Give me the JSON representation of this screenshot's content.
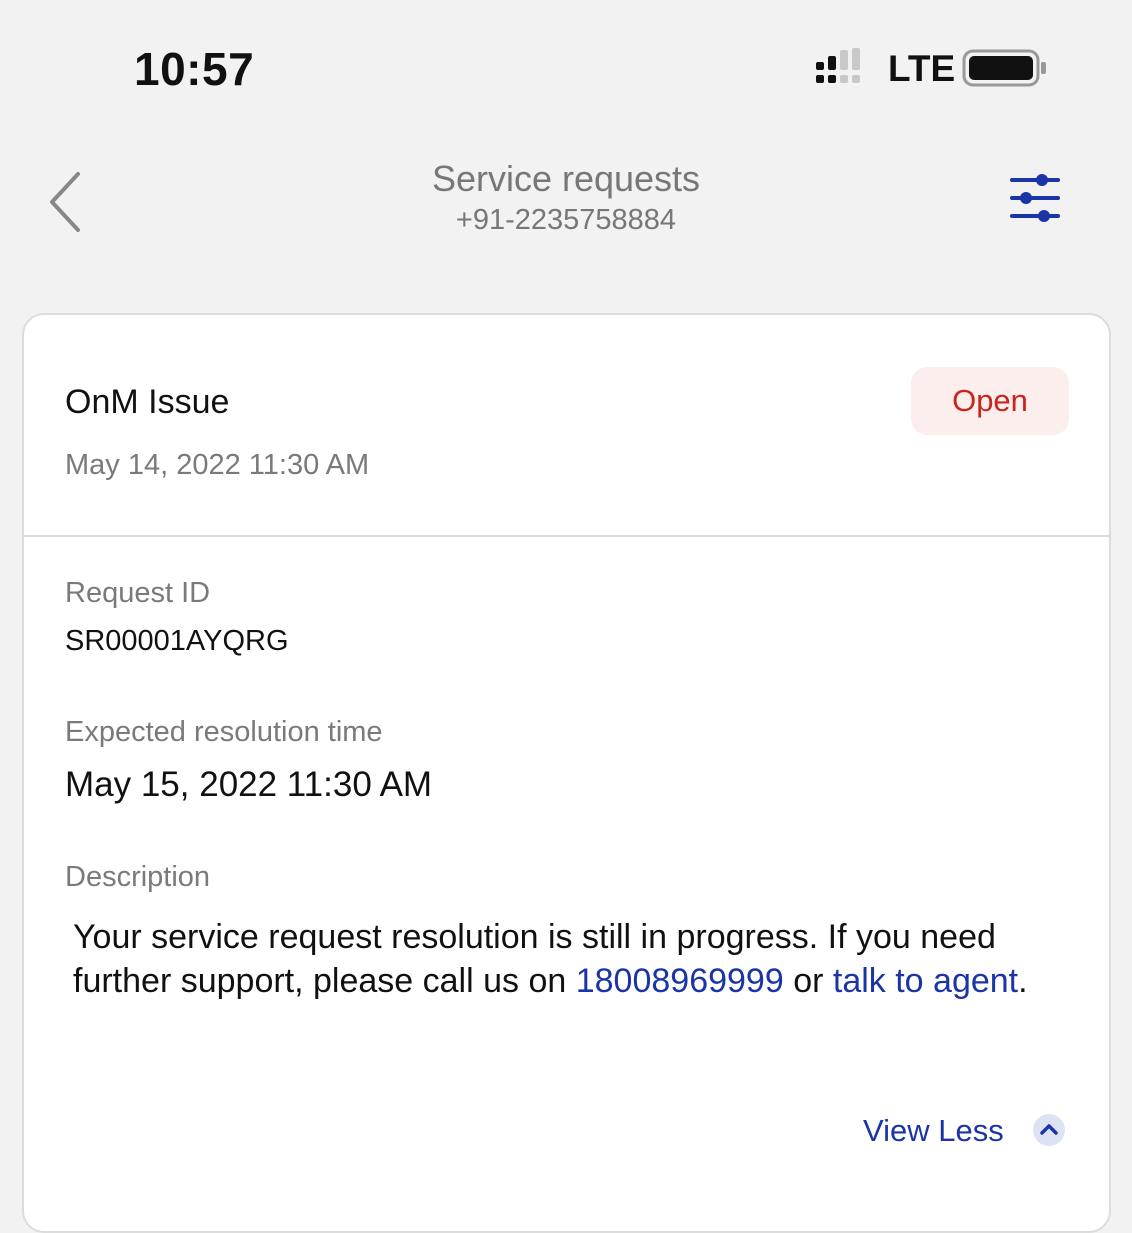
{
  "status_bar": {
    "time": "10:57",
    "network": "LTE"
  },
  "nav": {
    "title": "Service requests",
    "subtitle": "+91-2235758884"
  },
  "icons": {
    "back": "chevron-left-icon",
    "filter": "sliders-icon",
    "collapse": "chevron-up-icon"
  },
  "colors": {
    "accent": "#1b35a6",
    "status_open": "#c8261c",
    "status_open_bg": "#fdeeee"
  },
  "request": {
    "title": "OnM Issue",
    "date": "May 14, 2022 11:30 AM",
    "status": "Open",
    "id_label": "Request ID",
    "id": "SR00001AYQRG",
    "resolution_label": "Expected resolution time",
    "resolution": "May 15, 2022 11:30 AM",
    "description_label": "Description",
    "description_part1": "Your service request resolution is still in progress. If you need further support, please call us on ",
    "phone": "18008969999",
    "description_part2": " or ",
    "agent_link": "talk to agent",
    "description_part3": ".",
    "view_less": "View Less"
  }
}
